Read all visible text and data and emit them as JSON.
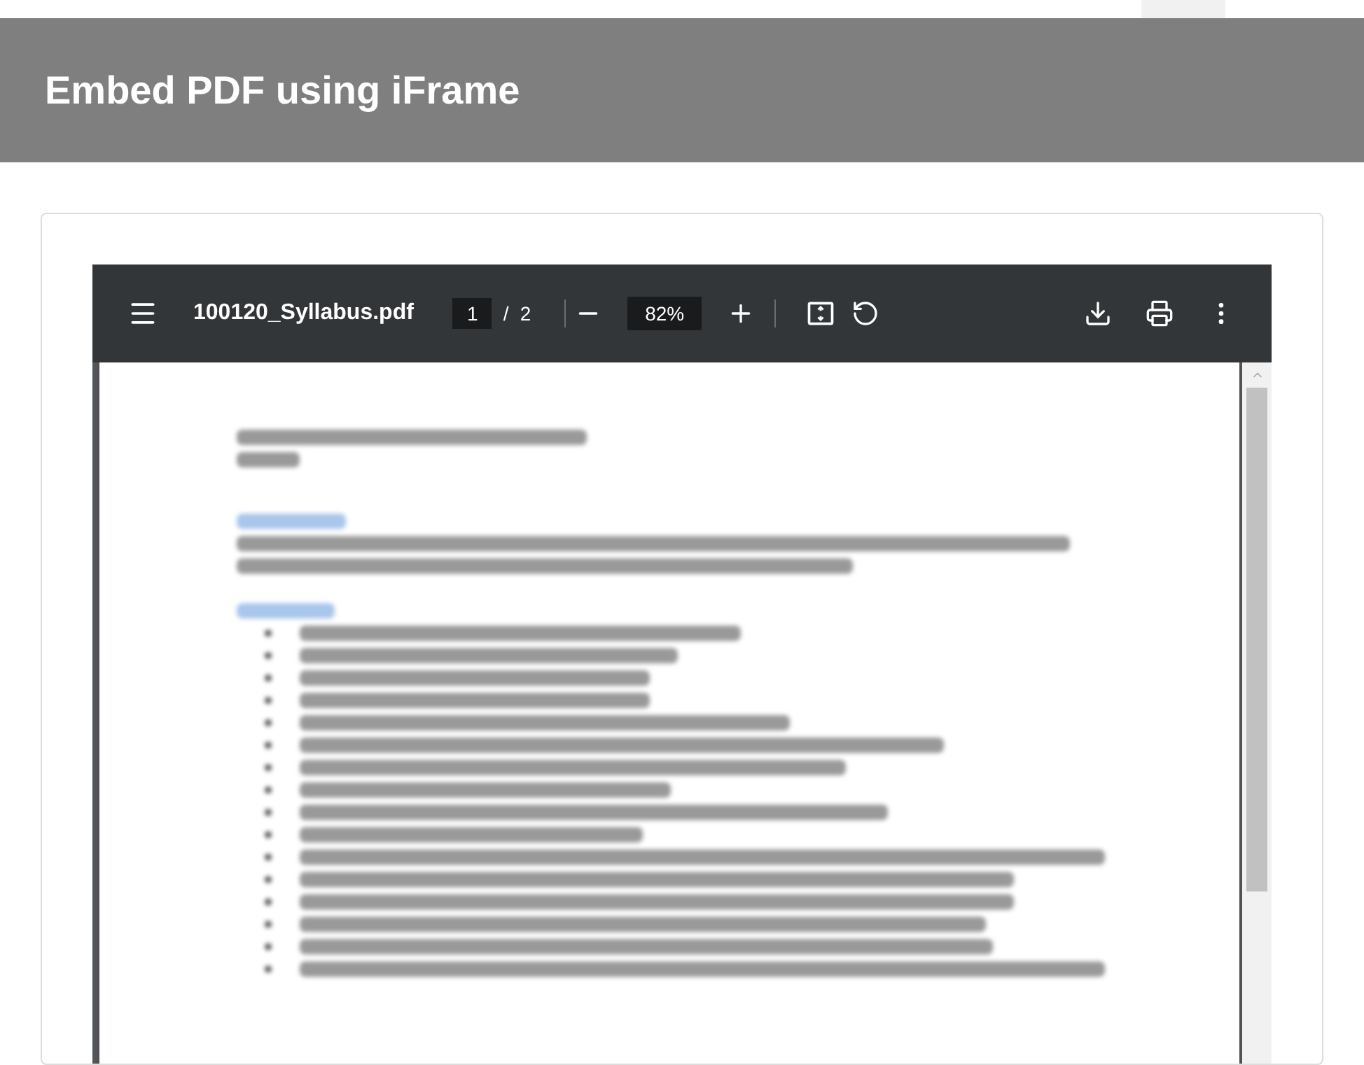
{
  "header": {
    "title": "Embed PDF using iFrame"
  },
  "viewer": {
    "file_name": "100120_Syllabus.pdf",
    "page": "1",
    "page_separator": "/",
    "page_count": "2",
    "zoom": "82%"
  }
}
